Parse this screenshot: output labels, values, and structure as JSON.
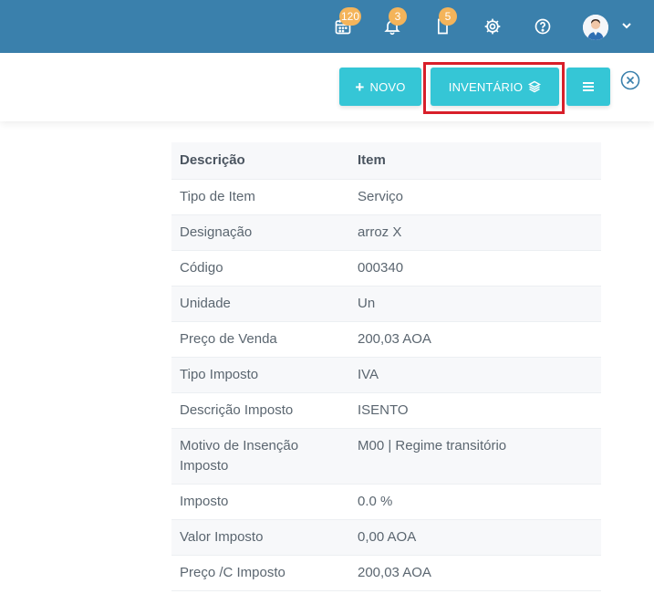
{
  "topbar": {
    "calendar_badge": "120",
    "notifications_badge": "3",
    "documents_badge": "5",
    "icons": [
      "calendar-icon",
      "bell-icon",
      "document-icon",
      "gear-icon",
      "help-icon",
      "avatar",
      "chevron-down-icon"
    ]
  },
  "toolbar": {
    "novo_label": "NOVO",
    "inventario_label": "INVENTÁRIO",
    "menu_icon": "hamburger-icon",
    "close_icon": "close-circle-icon"
  },
  "table": {
    "header": {
      "col1": "Descrição",
      "col2": "Item"
    },
    "rows": [
      {
        "label": "Tipo de Item",
        "value": "Serviço"
      },
      {
        "label": "Designação",
        "value": "arroz X"
      },
      {
        "label": "Código",
        "value": "000340"
      },
      {
        "label": "Unidade",
        "value": "Un"
      },
      {
        "label": "Preço de Venda",
        "value": "200,03 AOA"
      },
      {
        "label": "Tipo Imposto",
        "value": "IVA"
      },
      {
        "label": "Descrição Imposto",
        "value": "ISENTO"
      },
      {
        "label": "Motivo de Insenção Imposto",
        "value": "M00 | Regime transitório"
      },
      {
        "label": "Imposto",
        "value": "0.0 %"
      },
      {
        "label": "Valor Imposto",
        "value": "0,00 AOA"
      },
      {
        "label": "Preço /C Imposto",
        "value": "200,03 AOA"
      }
    ]
  },
  "colors": {
    "topbar": "#3a80ac",
    "button": "#35c6d6",
    "badge": "#f4b45a",
    "highlight": "#d81f2a"
  }
}
